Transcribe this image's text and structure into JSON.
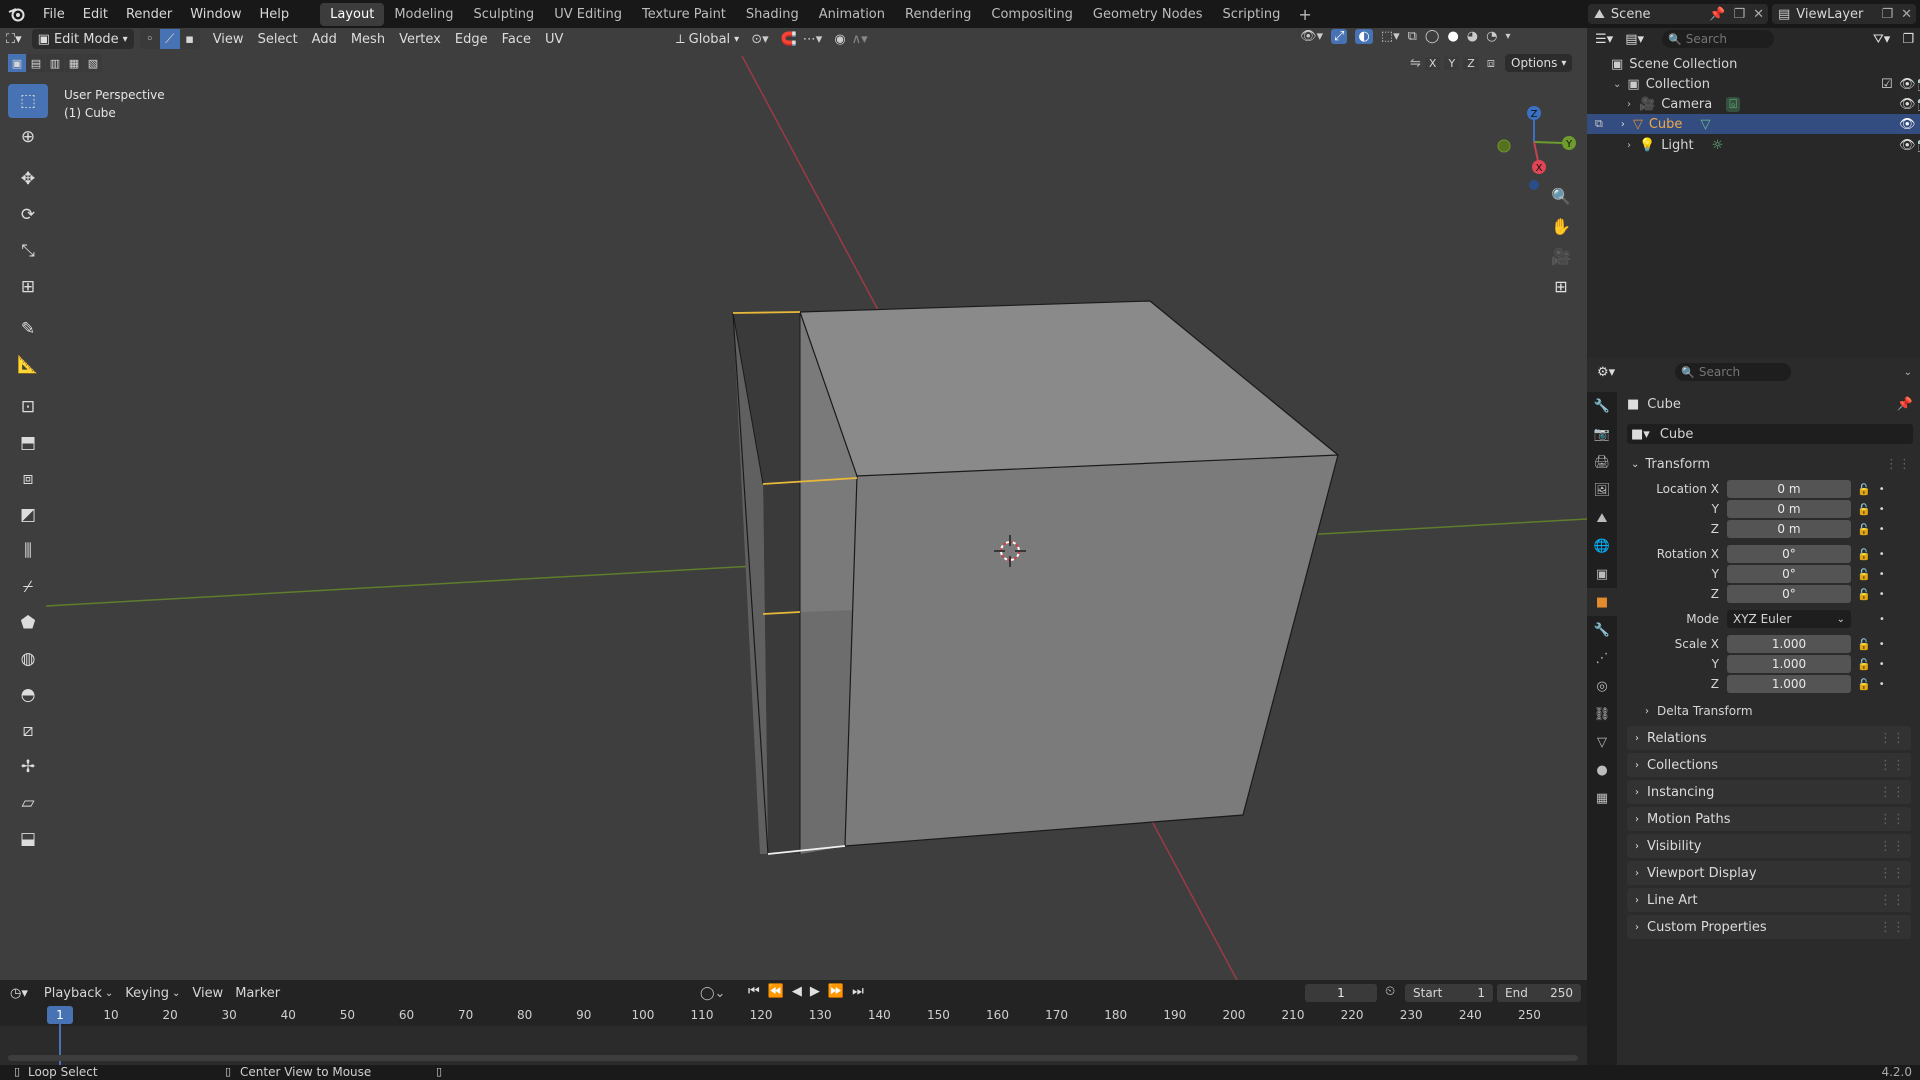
{
  "menu": {
    "items": [
      "File",
      "Edit",
      "Render",
      "Window",
      "Help"
    ]
  },
  "workspaces": [
    "Layout",
    "Modeling",
    "Sculpting",
    "UV Editing",
    "Texture Paint",
    "Shading",
    "Animation",
    "Rendering",
    "Compositing",
    "Geometry Nodes",
    "Scripting"
  ],
  "scene": {
    "name": "Scene",
    "view_layer": "ViewLayer"
  },
  "viewport": {
    "mode": "Edit Mode",
    "menus": [
      "View",
      "Select",
      "Add",
      "Mesh",
      "Vertex",
      "Edge",
      "Face",
      "UV"
    ],
    "transform_orientation": "Global",
    "options_label": "Options",
    "axes": [
      "X",
      "Y",
      "Z"
    ],
    "overlay_title": "User Perspective",
    "overlay_object": "(1) Cube",
    "gizmo": {
      "x": "X",
      "y": "Y",
      "z": "Z"
    }
  },
  "outliner": {
    "search_placeholder": "Search",
    "root": "Scene Collection",
    "collection": "Collection",
    "items": [
      {
        "label": "Camera",
        "selected": false
      },
      {
        "label": "Cube",
        "selected": true
      },
      {
        "label": "Light",
        "selected": false
      }
    ]
  },
  "properties": {
    "search_placeholder": "Search",
    "object_name": "Cube",
    "data_name": "Cube",
    "transform_label": "Transform",
    "location": {
      "label": "Location X",
      "x": "0 m",
      "y": "0 m",
      "z": "0 m"
    },
    "rotation": {
      "label": "Rotation X",
      "x": "0°",
      "y": "0°",
      "z": "0°"
    },
    "mode": {
      "label": "Mode",
      "value": "XYZ Euler"
    },
    "scale": {
      "label": "Scale X",
      "x": "1.000",
      "y": "1.000",
      "z": "1.000"
    },
    "axis_y": "Y",
    "axis_z": "Z",
    "delta_transform": "Delta Transform",
    "panels": [
      "Relations",
      "Collections",
      "Instancing",
      "Motion Paths",
      "Visibility",
      "Viewport Display",
      "Line Art",
      "Custom Properties"
    ]
  },
  "timeline": {
    "menus": [
      "Playback",
      "Keying",
      "View",
      "Marker"
    ],
    "current_frame": "1",
    "start_label": "Start",
    "start": "1",
    "end_label": "End",
    "end": "250",
    "ruler": [
      "10",
      "20",
      "30",
      "40",
      "50",
      "60",
      "70",
      "80",
      "90",
      "100",
      "110",
      "120",
      "130",
      "140",
      "150",
      "160",
      "170",
      "180",
      "190",
      "200",
      "210",
      "220",
      "230",
      "240",
      "250"
    ],
    "playhead": "1"
  },
  "status": {
    "left": "Loop Select",
    "middle": "Center View to Mouse",
    "version": "4.2.0"
  },
  "colors": {
    "accent": "#4772b3",
    "selected_edge": "#e8b83a",
    "x_axis": "#c4424f",
    "y_axis": "#6e9c2c",
    "object_orange": "#e38b2f"
  }
}
